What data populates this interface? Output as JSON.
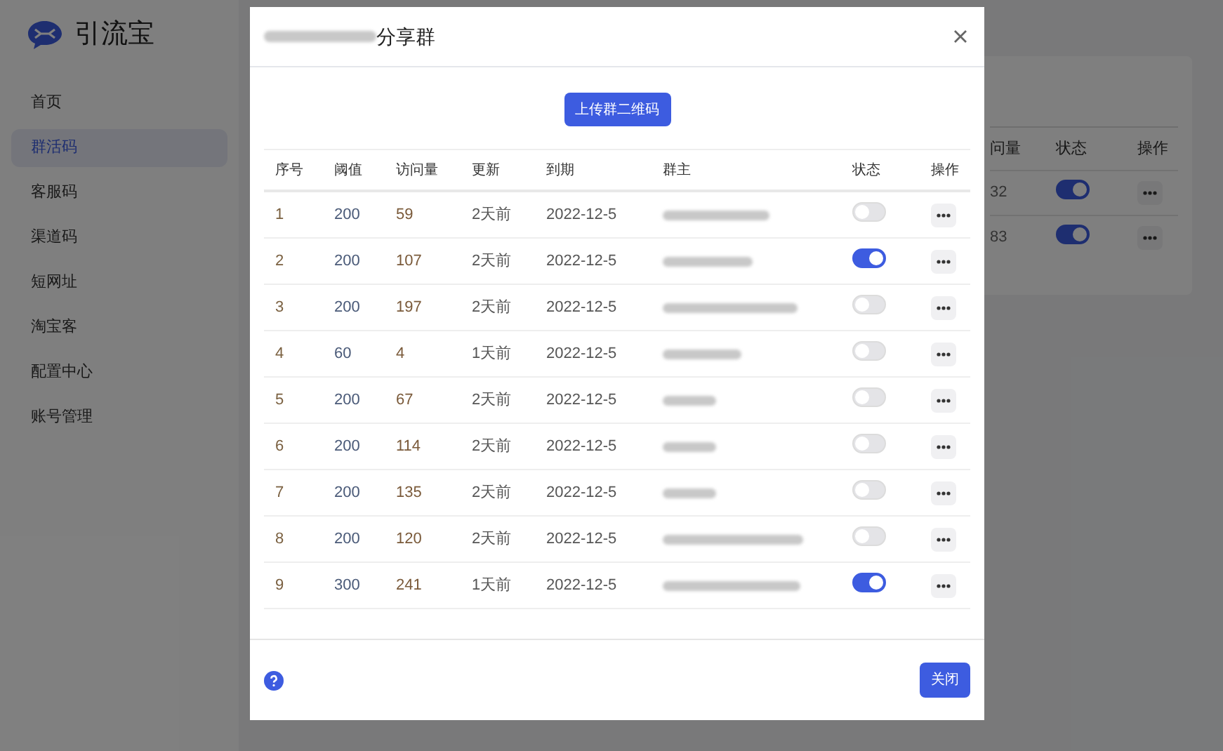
{
  "sidebar": {
    "logo": "引流宝",
    "items": [
      {
        "label": "首页",
        "selected": false
      },
      {
        "label": "群活码",
        "selected": true
      },
      {
        "label": "客服码",
        "selected": false
      },
      {
        "label": "渠道码",
        "selected": false
      },
      {
        "label": "短网址",
        "selected": false
      },
      {
        "label": "淘宝客",
        "selected": false
      },
      {
        "label": "配置中心",
        "selected": false
      },
      {
        "label": "账号管理",
        "selected": false
      }
    ]
  },
  "background_table": {
    "columns": [
      "问量",
      "状态",
      "操作"
    ],
    "rows": [
      {
        "visits": "32",
        "on": true
      },
      {
        "visits": "83",
        "on": true
      }
    ]
  },
  "dialog": {
    "title": "分享群",
    "upload_button": "上传群二维码",
    "columns": [
      "序号",
      "阈值",
      "访问量",
      "更新",
      "到期",
      "群主",
      "状态",
      "操作"
    ],
    "rows": [
      {
        "index": "1",
        "threshold": "200",
        "visits": "59",
        "updated": "2天前",
        "expires": "2022-12-5",
        "on": false
      },
      {
        "index": "2",
        "threshold": "200",
        "visits": "107",
        "updated": "2天前",
        "expires": "2022-12-5",
        "on": true
      },
      {
        "index": "3",
        "threshold": "200",
        "visits": "197",
        "updated": "2天前",
        "expires": "2022-12-5",
        "on": false
      },
      {
        "index": "4",
        "threshold": "60",
        "visits": "4",
        "updated": "1天前",
        "expires": "2022-12-5",
        "on": false
      },
      {
        "index": "5",
        "threshold": "200",
        "visits": "67",
        "updated": "2天前",
        "expires": "2022-12-5",
        "on": false
      },
      {
        "index": "6",
        "threshold": "200",
        "visits": "114",
        "updated": "2天前",
        "expires": "2022-12-5",
        "on": false
      },
      {
        "index": "7",
        "threshold": "200",
        "visits": "135",
        "updated": "2天前",
        "expires": "2022-12-5",
        "on": false
      },
      {
        "index": "8",
        "threshold": "200",
        "visits": "120",
        "updated": "2天前",
        "expires": "2022-12-5",
        "on": false
      },
      {
        "index": "9",
        "threshold": "300",
        "visits": "241",
        "updated": "1天前",
        "expires": "2022-12-5",
        "on": true
      }
    ],
    "close_button": "关闭"
  }
}
